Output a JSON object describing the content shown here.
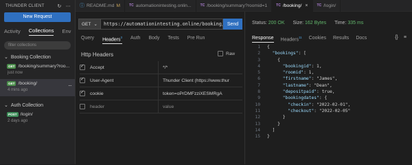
{
  "sidebar": {
    "title": "THUNDER CLIENT",
    "new_request": "New Request",
    "tabs": [
      "Activity",
      "Collections",
      "Env"
    ],
    "filter_placeholder": "filter collections",
    "collections": [
      {
        "name": "Booking Collection",
        "requests": [
          {
            "method": "GET",
            "name": "/booking/summary?roo...",
            "time": "just now"
          },
          {
            "method": "GET",
            "name": "/booking/",
            "time": "4 mins ago"
          }
        ]
      },
      {
        "name": "Auth Collection",
        "requests": [
          {
            "method": "POST",
            "name": "/login/",
            "time": "2 days ago"
          }
        ]
      }
    ]
  },
  "editor_tabs": [
    {
      "icon": "markdown-icon",
      "label": "README.md",
      "suffix": "M"
    },
    {
      "icon": "TC",
      "label": "automationintesting.onlin..."
    },
    {
      "icon": "TC",
      "label": "/booking/summary?roomid=1"
    },
    {
      "icon": "TC",
      "label": "/booking/"
    },
    {
      "icon": "TC",
      "label": "/login/"
    }
  ],
  "request": {
    "method": "GET",
    "url": "https://automationintesting.online/booking/",
    "send": "Send",
    "tabs": [
      "Query",
      "Headers",
      "Auth",
      "Body",
      "Tests",
      "Pre Run"
    ],
    "headers_count": "3",
    "section_title": "Http Headers",
    "raw_label": "Raw",
    "headers": [
      {
        "key": "Accept",
        "value": "*/*"
      },
      {
        "key": "User-Agent",
        "value": "Thunder Client (https://www.thur"
      },
      {
        "key": "cookie",
        "value": "token=oPrDMFzziXESMRgA"
      }
    ],
    "new_header_placeholder": {
      "key": "header",
      "value": "value"
    }
  },
  "response": {
    "status_label": "Status:",
    "status_value": "200 OK",
    "size_label": "Size:",
    "size_value": "162 Bytes",
    "time_label": "Time:",
    "time_value": "335 ms",
    "tabs": [
      "Response",
      "Headers",
      "Cookies",
      "Results",
      "Docs"
    ],
    "headers_count": "11",
    "code_lines": [
      {
        "n": "1",
        "t": "{"
      },
      {
        "n": "2",
        "t": "  \"bookings\": ["
      },
      {
        "n": "3",
        "t": "    {"
      },
      {
        "n": "4",
        "t": "      \"bookingid\": 1,"
      },
      {
        "n": "5",
        "t": "      \"roomid\": 1,"
      },
      {
        "n": "6",
        "t": "      \"firstname\": \"James\","
      },
      {
        "n": "7",
        "t": "      \"lastname\": \"Dean\","
      },
      {
        "n": "8",
        "t": "      \"depositpaid\": true,"
      },
      {
        "n": "9",
        "t": "      \"bookingdates\": {"
      },
      {
        "n": "10",
        "t": "        \"checkin\": \"2022-02-01\","
      },
      {
        "n": "11",
        "t": "        \"checkout\": \"2022-02-05\""
      },
      {
        "n": "12",
        "t": "      }"
      },
      {
        "n": "13",
        "t": "    }"
      },
      {
        "n": "14",
        "t": "  ]"
      },
      {
        "n": "15",
        "t": "}"
      }
    ]
  }
}
